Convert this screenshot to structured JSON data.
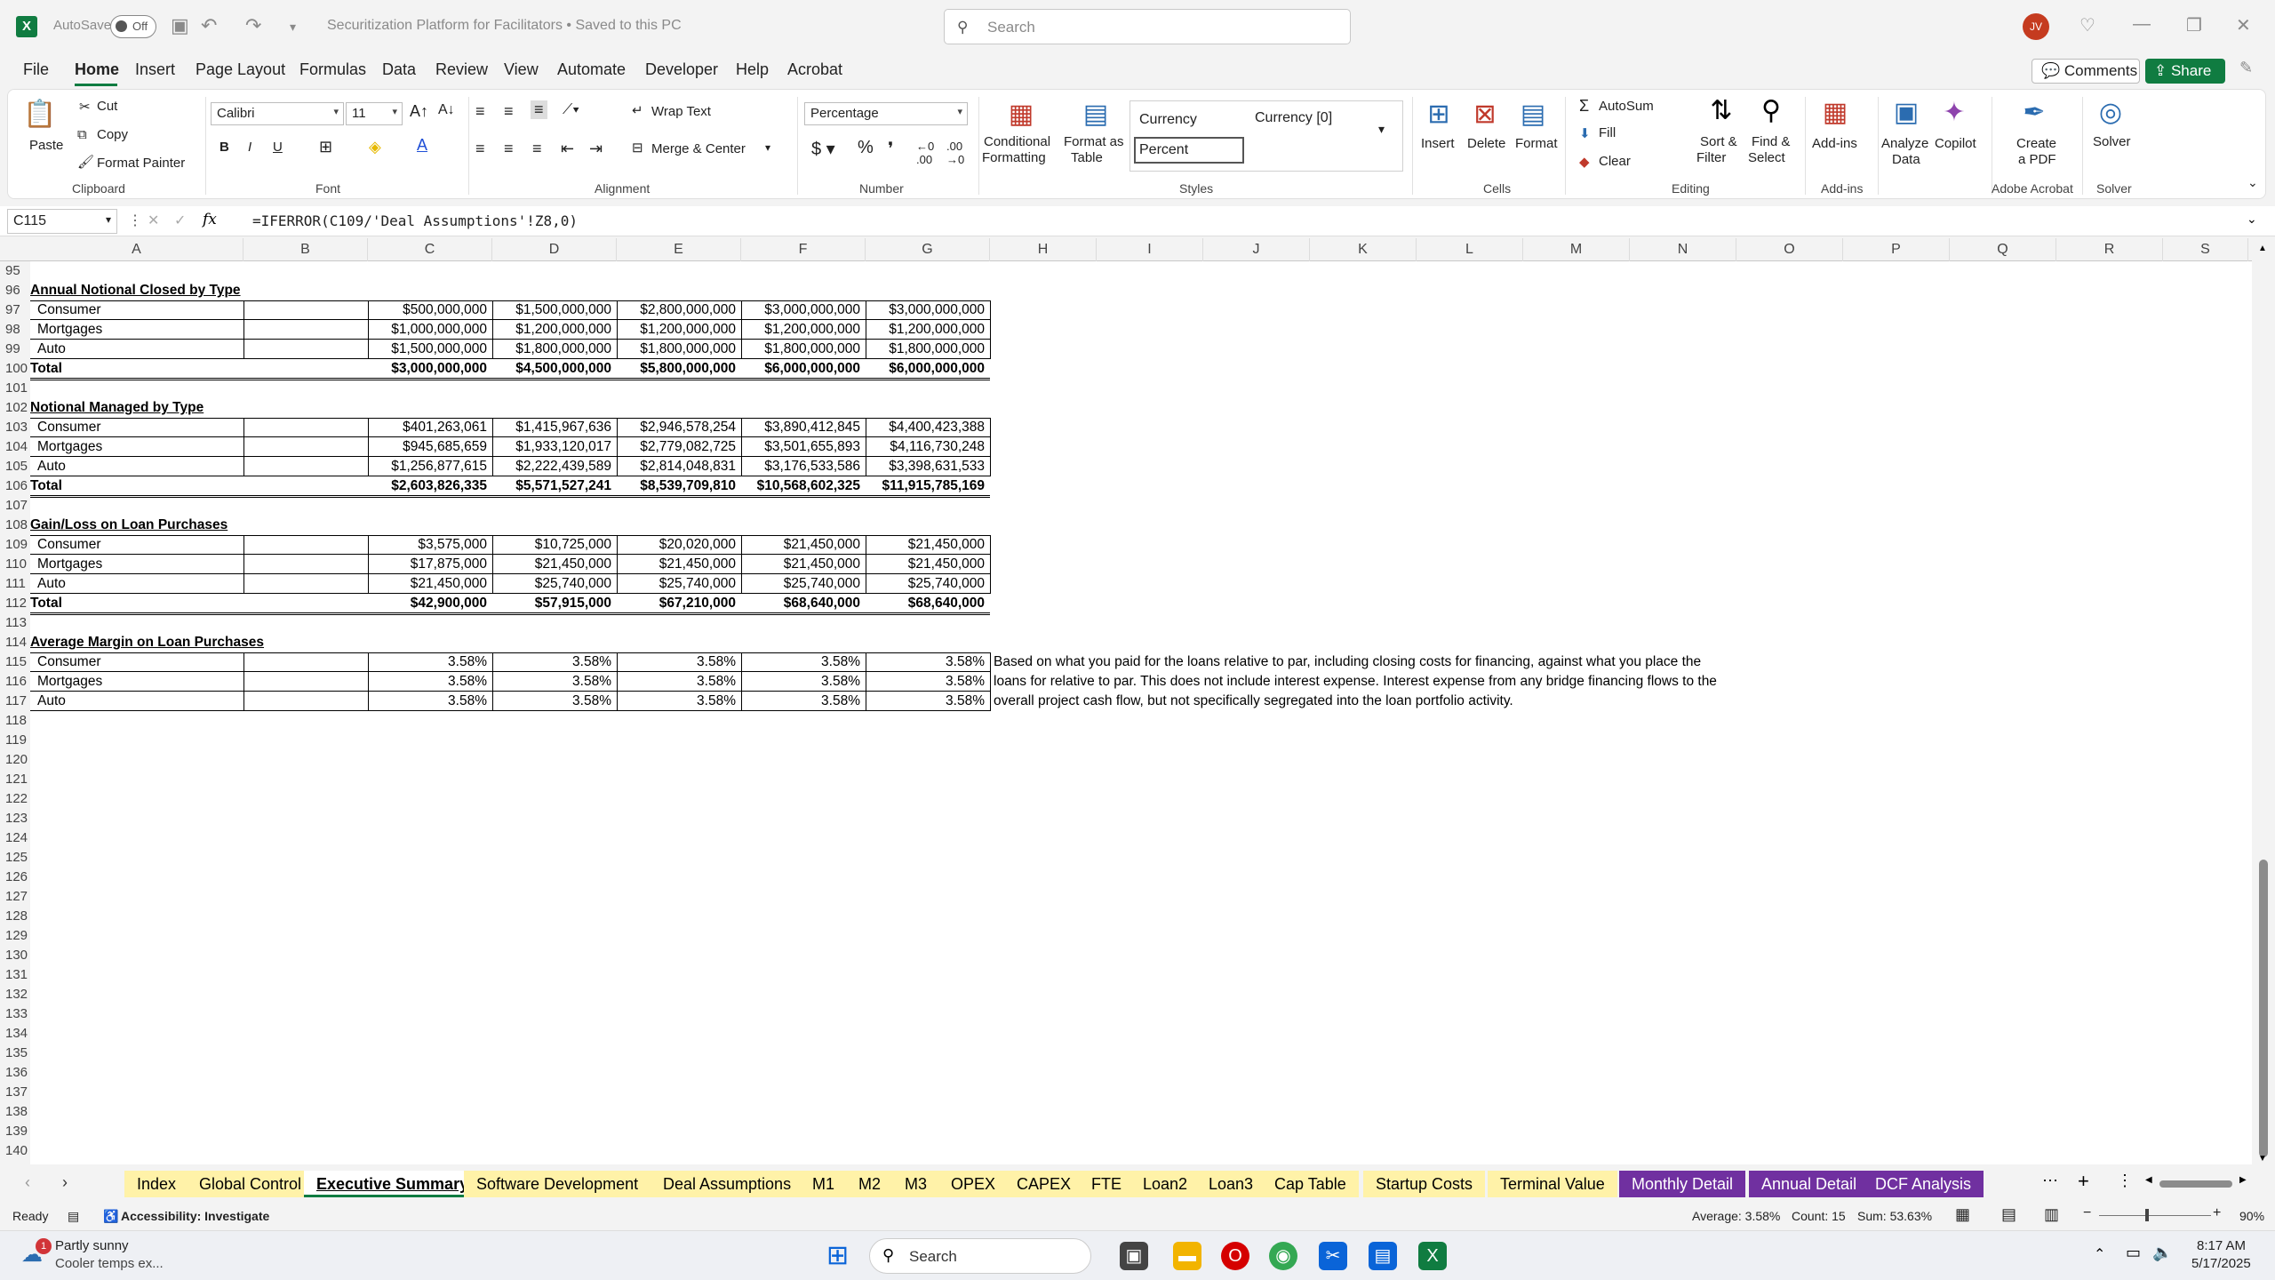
{
  "titlebar": {
    "autosave_label": "AutoSave",
    "toggle_state": "Off",
    "doc_title": "Securitization Platform for Facilitators • Saved to this PC",
    "search_placeholder": "Search",
    "avatar_initials": "JV"
  },
  "menu": {
    "tabs": [
      "File",
      "Home",
      "Insert",
      "Page Layout",
      "Formulas",
      "Data",
      "Review",
      "View",
      "Automate",
      "Developer",
      "Help",
      "Acrobat"
    ],
    "active": "Home",
    "comments": "Comments",
    "share": "Share"
  },
  "ribbon": {
    "clipboard": {
      "paste": "Paste",
      "cut": "Cut",
      "copy": "Copy",
      "format_painter": "Format Painter",
      "group": "Clipboard"
    },
    "font": {
      "family": "Calibri",
      "size": "11",
      "group": "Font"
    },
    "alignment": {
      "wrap_text": "Wrap Text",
      "merge_center": "Merge & Center",
      "group": "Alignment"
    },
    "number": {
      "format": "Percentage",
      "group": "Number"
    },
    "styles": {
      "conditional": "Conditional",
      "conditional2": "Formatting",
      "format_as": "Format as",
      "format_as2": "Table",
      "currency": "Currency",
      "currency0": "Currency [0]",
      "percent": "Percent",
      "group": "Styles"
    },
    "cells": {
      "insert": "Insert",
      "delete": "Delete",
      "format": "Format",
      "group": "Cells"
    },
    "editing": {
      "autosum": "AutoSum",
      "fill": "Fill",
      "clear": "Clear",
      "sort": "Sort &",
      "sort2": "Filter",
      "find": "Find &",
      "find2": "Select",
      "group": "Editing"
    },
    "addins": {
      "label": "Add-ins",
      "group": "Add-ins"
    },
    "analyze": {
      "label": "Analyze",
      "label2": "Data"
    },
    "copilot": {
      "label": "Copilot"
    },
    "acrobat": {
      "label": "Create",
      "label2": "a PDF",
      "group": "Adobe Acrobat"
    },
    "solver": {
      "label": "Solver",
      "group": "Solver"
    }
  },
  "formula_bar": {
    "name_box": "C115",
    "fx": "fx",
    "formula": "=IFERROR(C109/'Deal Assumptions'!Z8,0)"
  },
  "columns": [
    "A",
    "B",
    "C",
    "D",
    "E",
    "F",
    "G",
    "H",
    "I",
    "J",
    "K",
    "L",
    "M",
    "N",
    "O",
    "P",
    "Q",
    "R",
    "S"
  ],
  "rows": [
    "95",
    "96",
    "97",
    "98",
    "99",
    "100",
    "101",
    "102",
    "103",
    "104",
    "105",
    "106",
    "107",
    "108",
    "109",
    "110",
    "111",
    "112",
    "113",
    "114",
    "115",
    "116",
    "117",
    "118",
    "119",
    "120",
    "121",
    "122",
    "123",
    "124",
    "125",
    "126",
    "127",
    "128",
    "129",
    "130",
    "131",
    "132",
    "133",
    "134",
    "135",
    "136",
    "137",
    "138",
    "139",
    "140"
  ],
  "sections": {
    "annual_notional": {
      "title": "Annual Notional Closed by Type",
      "rows": [
        {
          "label": "Consumer",
          "values": [
            "$500,000,000",
            "$1,500,000,000",
            "$2,800,000,000",
            "$3,000,000,000",
            "$3,000,000,000"
          ]
        },
        {
          "label": "Mortgages",
          "values": [
            "$1,000,000,000",
            "$1,200,000,000",
            "$1,200,000,000",
            "$1,200,000,000",
            "$1,200,000,000"
          ]
        },
        {
          "label": "Auto",
          "values": [
            "$1,500,000,000",
            "$1,800,000,000",
            "$1,800,000,000",
            "$1,800,000,000",
            "$1,800,000,000"
          ]
        }
      ],
      "total": {
        "label": "Total",
        "values": [
          "$3,000,000,000",
          "$4,500,000,000",
          "$5,800,000,000",
          "$6,000,000,000",
          "$6,000,000,000"
        ]
      }
    },
    "notional_managed": {
      "title": "Notional Managed by Type",
      "rows": [
        {
          "label": "Consumer",
          "values": [
            "$401,263,061",
            "$1,415,967,636",
            "$2,946,578,254",
            "$3,890,412,845",
            "$4,400,423,388"
          ]
        },
        {
          "label": "Mortgages",
          "values": [
            "$945,685,659",
            "$1,933,120,017",
            "$2,779,082,725",
            "$3,501,655,893",
            "$4,116,730,248"
          ]
        },
        {
          "label": "Auto",
          "values": [
            "$1,256,877,615",
            "$2,222,439,589",
            "$2,814,048,831",
            "$3,176,533,586",
            "$3,398,631,533"
          ]
        }
      ],
      "total": {
        "label": "Total",
        "values": [
          "$2,603,826,335",
          "$5,571,527,241",
          "$8,539,709,810",
          "$10,568,602,325",
          "$11,915,785,169"
        ]
      }
    },
    "gain_loss": {
      "title": "Gain/Loss on Loan Purchases",
      "rows": [
        {
          "label": "Consumer",
          "values": [
            "$3,575,000",
            "$10,725,000",
            "$20,020,000",
            "$21,450,000",
            "$21,450,000"
          ]
        },
        {
          "label": "Mortgages",
          "values": [
            "$17,875,000",
            "$21,450,000",
            "$21,450,000",
            "$21,450,000",
            "$21,450,000"
          ]
        },
        {
          "label": "Auto",
          "values": [
            "$21,450,000",
            "$25,740,000",
            "$25,740,000",
            "$25,740,000",
            "$25,740,000"
          ]
        }
      ],
      "total": {
        "label": "Total",
        "values": [
          "$42,900,000",
          "$57,915,000",
          "$67,210,000",
          "$68,640,000",
          "$68,640,000"
        ]
      }
    },
    "avg_margin": {
      "title": "Average Margin on Loan Purchases",
      "rows": [
        {
          "label": "Consumer",
          "values": [
            "3.58%",
            "3.58%",
            "3.58%",
            "3.58%",
            "3.58%"
          ]
        },
        {
          "label": "Mortgages",
          "values": [
            "3.58%",
            "3.58%",
            "3.58%",
            "3.58%",
            "3.58%"
          ]
        },
        {
          "label": "Auto",
          "values": [
            "3.58%",
            "3.58%",
            "3.58%",
            "3.58%",
            "3.58%"
          ]
        }
      ],
      "note": [
        "Based on what you paid for the loans relative to par, including closing costs for financing, against what you place the",
        "loans for relative to par. This does not include interest expense. Interest expense from any bridge financing flows to the",
        "overall project cash flow, but not specifically segregated into the loan portfolio activity."
      ]
    }
  },
  "sheet_tabs": [
    {
      "name": "Index",
      "color": "#fff2a8"
    },
    {
      "name": "Global Control",
      "color": "#fff2a8"
    },
    {
      "name": "Executive Summary",
      "color": "#ffffff"
    },
    {
      "name": "Software Development",
      "color": "#fff2a8"
    },
    {
      "name": "Deal Assumptions",
      "color": "#fff2a8"
    },
    {
      "name": "M1",
      "color": "#fff2a8"
    },
    {
      "name": "M2",
      "color": "#fff2a8"
    },
    {
      "name": "M3",
      "color": "#fff2a8"
    },
    {
      "name": "OPEX",
      "color": "#fff2a8"
    },
    {
      "name": "CAPEX",
      "color": "#fff2a8"
    },
    {
      "name": "FTE",
      "color": "#fff2a8"
    },
    {
      "name": "Loan2",
      "color": "#fff2a8"
    },
    {
      "name": "Loan3",
      "color": "#fff2a8"
    },
    {
      "name": "Cap Table",
      "color": "#fff2a8"
    },
    {
      "name": "Startup Costs",
      "color": "#fff2a8"
    },
    {
      "name": "Terminal Value",
      "color": "#fff2a8"
    },
    {
      "name": "Monthly Detail",
      "color": "#7030a0"
    },
    {
      "name": "Annual Detail",
      "color": "#7030a0"
    },
    {
      "name": "DCF Analysis",
      "color": "#7030a0"
    }
  ],
  "status": {
    "ready": "Ready",
    "accessibility": "Accessibility: Investigate",
    "average": "Average: 3.58%",
    "count": "Count: 15",
    "sum": "Sum: 53.63%",
    "zoom": "90%"
  },
  "taskbar": {
    "weather_title": "Partly sunny",
    "weather_sub": "Cooler temps ex...",
    "weather_badge": "1",
    "search": "Search",
    "time": "8:17 AM",
    "date": "5/17/2025"
  }
}
